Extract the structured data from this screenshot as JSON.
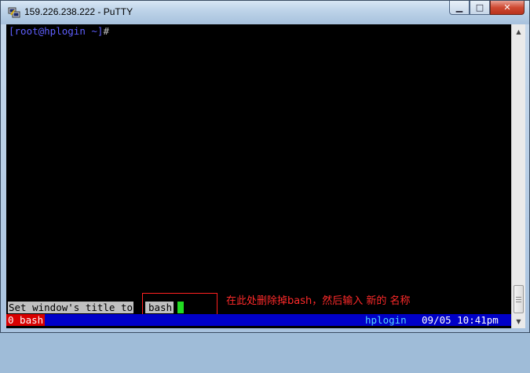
{
  "window": {
    "title": "159.226.238.222 - PuTTY",
    "controls": {
      "minimize_icon": "minimize-icon",
      "maximize_icon": "maximize-icon",
      "close_icon": "close-icon",
      "minimize_glyph": "▁",
      "maximize_glyph": "□",
      "close_glyph": "✕"
    }
  },
  "terminal": {
    "prompt": {
      "open_bracket": "[",
      "user_host": "root@hplogin",
      "path": " ~",
      "close_bracket": "]",
      "hash": "#"
    },
    "command_line": {
      "label": "Set window's title to",
      "value": "bash"
    },
    "annotation": "在此处删除掉bash，然后输入 新的 名称",
    "status_bar": {
      "window_tab": "0 bash",
      "hostname": "hplogin",
      "datetime": "09/05 10:41pm"
    },
    "colors": {
      "background": "#000000",
      "prompt": "#5f5fff",
      "status_bg": "#0000c8",
      "status_tab_bg": "#d80000",
      "status_host": "#55d7ff",
      "cursor": "#22dd22",
      "annotation": "#ff2a2a"
    }
  },
  "scrollbar": {
    "up_glyph": "▲",
    "down_glyph": "▼"
  }
}
